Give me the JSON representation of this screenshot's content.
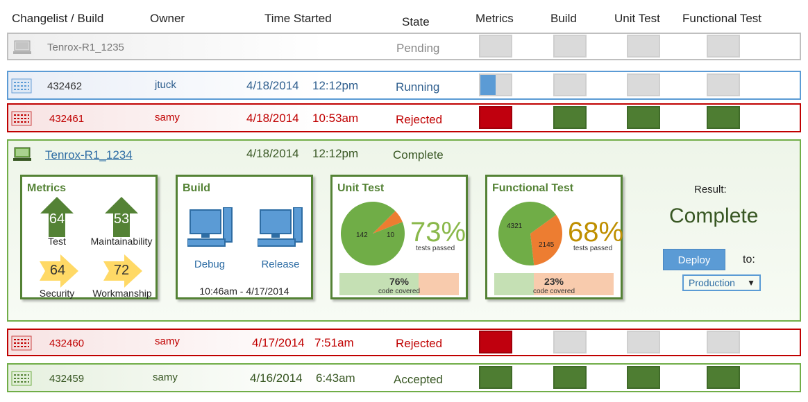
{
  "headers": {
    "changelist": "Changelist / Build",
    "owner": "Owner",
    "time_started": "Time Started",
    "state": "State",
    "metrics": "Metrics",
    "build": "Build",
    "unit_test": "Unit Test",
    "functional_test": "Functional Test"
  },
  "rows": [
    {
      "id": "Tenrox-R1_1235",
      "owner": "",
      "date": "",
      "time": "",
      "state": "Pending",
      "color": "#888888",
      "metrics_progress": 0
    },
    {
      "id": "432462",
      "owner": "jtuck",
      "date": "4/18/2014",
      "time": "12:12pm",
      "state": "Running",
      "color": "#2e5e8e",
      "metrics_progress": 0.5
    },
    {
      "id": "432461",
      "owner": "samy",
      "date": "4/18/2014",
      "time": "10:53am",
      "state": "Rejected",
      "color": "#c00000"
    },
    {
      "id": "Tenrox-R1_1234",
      "owner": "",
      "date": "4/18/2014",
      "time": "12:12pm",
      "state": "Complete",
      "color": "#385723"
    },
    {
      "id": "432460",
      "owner": "samy",
      "date": "4/17/2014",
      "time": "7:51am",
      "state": "Rejected",
      "color": "#c00000"
    },
    {
      "id": "432459",
      "owner": "samy",
      "date": "4/16/2014",
      "time": "6:43am",
      "state": "Accepted",
      "color": "#385723"
    }
  ],
  "details": {
    "metrics": {
      "title": "Metrics",
      "test": {
        "value": "64",
        "label": "Test"
      },
      "maintainability": {
        "value": "53",
        "label": "Maintainability"
      },
      "security": {
        "value": "64",
        "label": "Security"
      },
      "workmanship": {
        "value": "72",
        "label": "Workmanship"
      }
    },
    "build": {
      "title": "Build",
      "debug": "Debug",
      "release": "Release",
      "timestamp": "10:46am - 4/17/2014"
    },
    "unit_test": {
      "title": "Unit Test",
      "passed": 142,
      "failed": 10,
      "passed_label": "142",
      "failed_label": "10",
      "percent": "73%",
      "percent_sub": "tests passed",
      "coverage": "76%",
      "coverage_value": 0.66,
      "coverage_sub": "code covered"
    },
    "functional_test": {
      "title": "Functional Test",
      "passed": 4321,
      "failed": 2145,
      "passed_label": "4321",
      "failed_label": "2145",
      "percent": "68%",
      "percent_sub": "tests passed",
      "coverage": "23%",
      "coverage_value": 0.33,
      "coverage_sub": "code covered"
    },
    "result": {
      "label": "Result:",
      "value": "Complete",
      "deploy_button": "Deploy",
      "to_label": "to:",
      "target": "Production"
    }
  },
  "colors": {
    "green": "#548235",
    "red": "#c00000",
    "blue": "#5b9bd5",
    "orange": "#ed7d31",
    "pie_green": "#70ad47",
    "gold": "#bf8f00",
    "yellow": "#ffd966"
  }
}
